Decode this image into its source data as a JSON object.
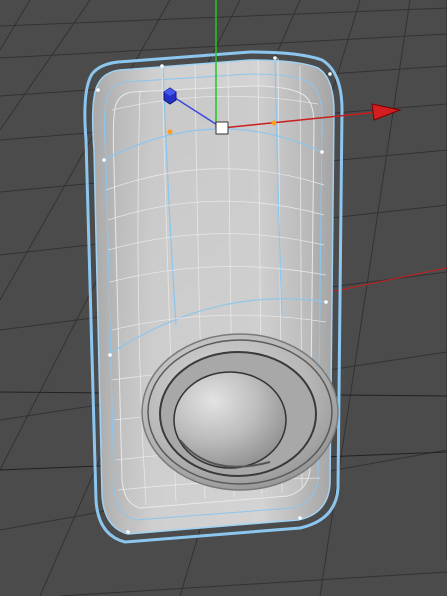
{
  "viewport": {
    "colors": {
      "background": "#4b4b4b",
      "grid": "#323232",
      "axis_x": "#c81e1e",
      "axis_y": "#1ec81e",
      "axis_z": "#1e2ac8",
      "selection_wire": "#8cc6ee",
      "wire": "#e9e9e9",
      "point": "#ff9c1a",
      "body_fill": "#c7c7c7"
    },
    "icons": {
      "x_handle": "x-axis-arrow-icon",
      "y_handle": "y-axis-handle-icon",
      "z_handle": "z-axis-cube-icon",
      "pivot": "pivot-handle-icon"
    }
  }
}
